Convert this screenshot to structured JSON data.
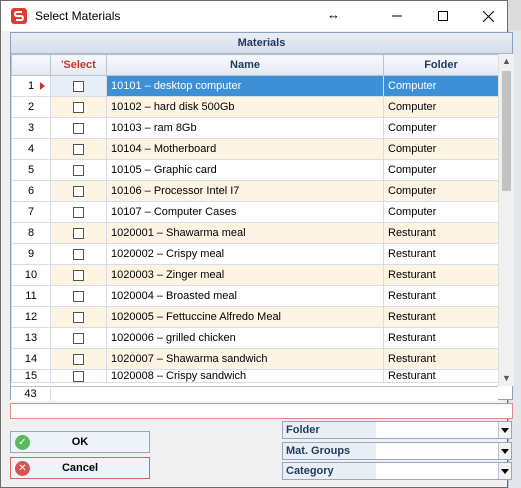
{
  "window": {
    "title": "Select Materials"
  },
  "grid": {
    "caption": "Materials",
    "columns": {
      "select": "Select",
      "name": "Name",
      "folder": "Folder"
    },
    "rows": [
      {
        "n": "1",
        "name": "10101 – desktop computer",
        "folder": "Computer"
      },
      {
        "n": "2",
        "name": "10102 – hard disk 500Gb",
        "folder": "Computer"
      },
      {
        "n": "3",
        "name": "10103 – ram 8Gb",
        "folder": "Computer"
      },
      {
        "n": "4",
        "name": "10104 – Motherboard",
        "folder": "Computer"
      },
      {
        "n": "5",
        "name": "10105 – Graphic card",
        "folder": "Computer"
      },
      {
        "n": "6",
        "name": "10106 – Processor Intel I7",
        "folder": "Computer"
      },
      {
        "n": "7",
        "name": "10107 – Computer Cases",
        "folder": "Computer"
      },
      {
        "n": "8",
        "name": "1020001 – Shawarma meal",
        "folder": "Resturant"
      },
      {
        "n": "9",
        "name": "1020002 – Crispy meal",
        "folder": "Resturant"
      },
      {
        "n": "10",
        "name": "1020003 – Zinger meal",
        "folder": "Resturant"
      },
      {
        "n": "11",
        "name": "1020004 – Broasted meal",
        "folder": "Resturant"
      },
      {
        "n": "12",
        "name": "1020005 – Fettuccine Alfredo Meal",
        "folder": "Resturant"
      },
      {
        "n": "13",
        "name": "1020006 – grilled chicken",
        "folder": "Resturant"
      },
      {
        "n": "14",
        "name": "1020007 – Shawarma sandwich",
        "folder": "Resturant"
      },
      {
        "n": "15",
        "name": "1020008 – Crispy sandwich",
        "folder": "Resturant"
      }
    ],
    "record_count": "43"
  },
  "buttons": {
    "ok": "OK",
    "cancel": "Cancel"
  },
  "filters": {
    "folder": "Folder",
    "mat_groups": "Mat. Groups",
    "category": "Category"
  },
  "colors": {
    "selection": "#3d8fd6",
    "alt_row": "#fdf4e3",
    "header_text": "#1e3a5f",
    "select_header": "#c0392b"
  }
}
